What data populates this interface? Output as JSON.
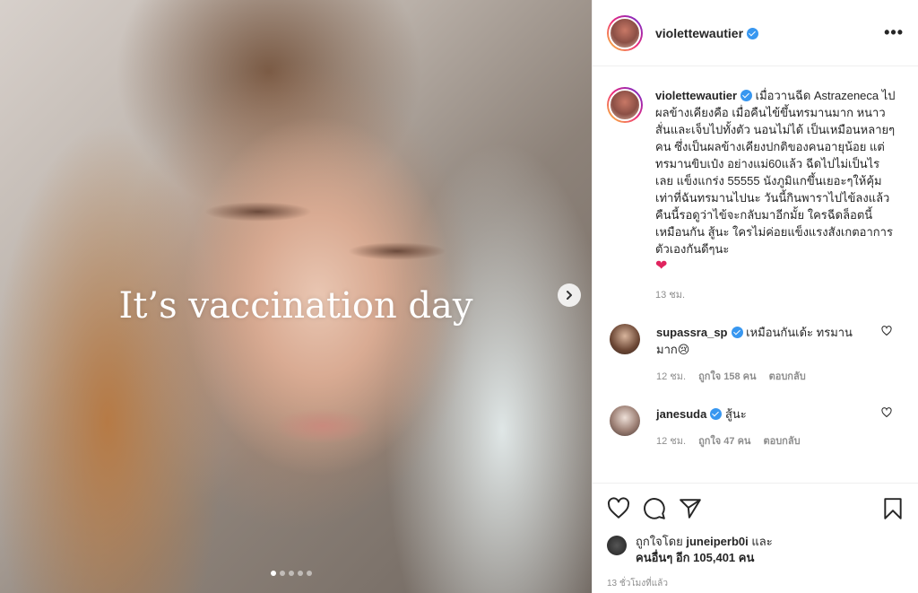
{
  "media": {
    "overlay_text": "It’s vaccination day",
    "slide_count": 5,
    "active_slide": 1
  },
  "header": {
    "username": "violettewautier",
    "more_label": "•••"
  },
  "caption": {
    "username": "violettewautier",
    "text": "เมื่อวานฉีด Astrazeneca ไป ผลข้างเคียงคือ เมื่อคืนไข้ขึ้นทรมานมาก หนาวสั่นและเจ็บไปทั้งตัว นอนไม่ได้ เป็นเหมือนหลายๆคน ซึ่งเป็นผลข้างเคียงปกติของคนอายุน้อย แต่ทรมานขิบเป๋ง อย่างแม่60แล้ว ฉีดไปไม่เป็นไรเลย แข็งแกร่ง 55555 นังภูมิแกขึ้นเยอะๆให้คุ้มเท่าที่ฉันทรมานไปนะ วันนี้กินพาราไปไข้ลงแล้ว คืนนี้รอดูว่าไข้จะกลับมาอีกมั้ย ใครฉีดล็อตนี้เหมือนกัน สู้นะ ใครไม่ค่อยแข็งแรงสังเกตอาการตัวเองกันดีๆนะ",
    "emoji": "❤",
    "timestamp": "13 ชม."
  },
  "comments": [
    {
      "username": "supassra_sp",
      "text": "เหมือนกันเด้ะ ทรมานมาก😢",
      "time": "12 ชม.",
      "likes": "ถูกใจ 158 คน",
      "reply": "ตอบกลับ"
    },
    {
      "username": "janesuda",
      "text": "สู้นะ",
      "time": "12 ชม.",
      "likes": "ถูกใจ 47 คน",
      "reply": "ตอบกลับ"
    }
  ],
  "actions": {
    "liked_by_prefix": "ถูกใจโดย",
    "liked_by_user": "juneiperb0i",
    "and": "และ",
    "others_count": "คนอื่นๆ อีก 105,401 คน",
    "post_time": "13 ชั่วโมงที่แล้ว"
  }
}
